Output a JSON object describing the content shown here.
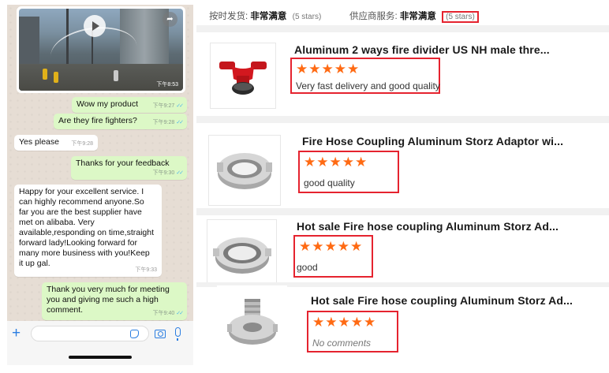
{
  "chat": {
    "video": {
      "time": "下午8:53",
      "play_icon": "play-icon",
      "forward_icon": "forward-icon"
    },
    "messages": [
      {
        "dir": "out",
        "text": "Wow my product",
        "time": "下午9:27",
        "ticks": "✓✓"
      },
      {
        "dir": "out",
        "text": "Are they fire fighters?",
        "time": "下午9:28",
        "ticks": "✓✓"
      },
      {
        "dir": "in",
        "text": "Yes please",
        "time": "下午9:28"
      },
      {
        "dir": "out",
        "text": "Thanks for your feedback",
        "time": "下午9:30",
        "ticks": "✓✓"
      },
      {
        "dir": "in",
        "text": "Happy for your excellent service. I can  highly recommend anyone.So far you are the best  supplier have met on alibaba. Very available,responding on time,straight forward lady!Looking forward for many more business with you!Keep it up gal.",
        "time": "下午9:33"
      },
      {
        "dir": "out",
        "text": "Thank you very much for meeting you and giving me such a high comment.",
        "time": "下午9:40",
        "ticks": "✓✓"
      }
    ],
    "input": {
      "placeholder": "",
      "icons": [
        "plus-icon",
        "sticker-icon",
        "camera-icon",
        "mic-icon"
      ]
    },
    "colors": {
      "outgoing": "#dcf8c6",
      "incoming": "#ffffff",
      "background": "#e6ddd4",
      "accent": "#2a7de1"
    }
  },
  "summary": {
    "delivery_label": "按时发货:",
    "delivery_value": "非常满意",
    "delivery_stars": "(5 stars)",
    "service_label": "供应商服务:",
    "service_value": "非常满意",
    "service_stars": "(5 stars)"
  },
  "reviews": [
    {
      "title": "Aluminum 2 ways fire divider US NH male thre...",
      "rating": 5,
      "stars": "★★★★★",
      "comment": "Very fast delivery and good quality",
      "has_comment": true
    },
    {
      "title": "Fire Hose Coupling Aluminum Storz Adaptor wi...",
      "rating": 5,
      "stars": "★★★★★",
      "comment": "good quality",
      "has_comment": true
    },
    {
      "title": "Hot sale Fire hose coupling Aluminum Storz Ad...",
      "rating": 5,
      "stars": "★★★★★",
      "comment": "good",
      "has_comment": true
    },
    {
      "title": "Hot sale Fire hose coupling Aluminum Storz Ad...",
      "rating": 5,
      "stars": "★★★★★",
      "comment": "No comments",
      "has_comment": false
    }
  ],
  "colors": {
    "star": "#ff6a13",
    "highlight_box": "#e5232f",
    "divider": "#f1f1f1"
  }
}
